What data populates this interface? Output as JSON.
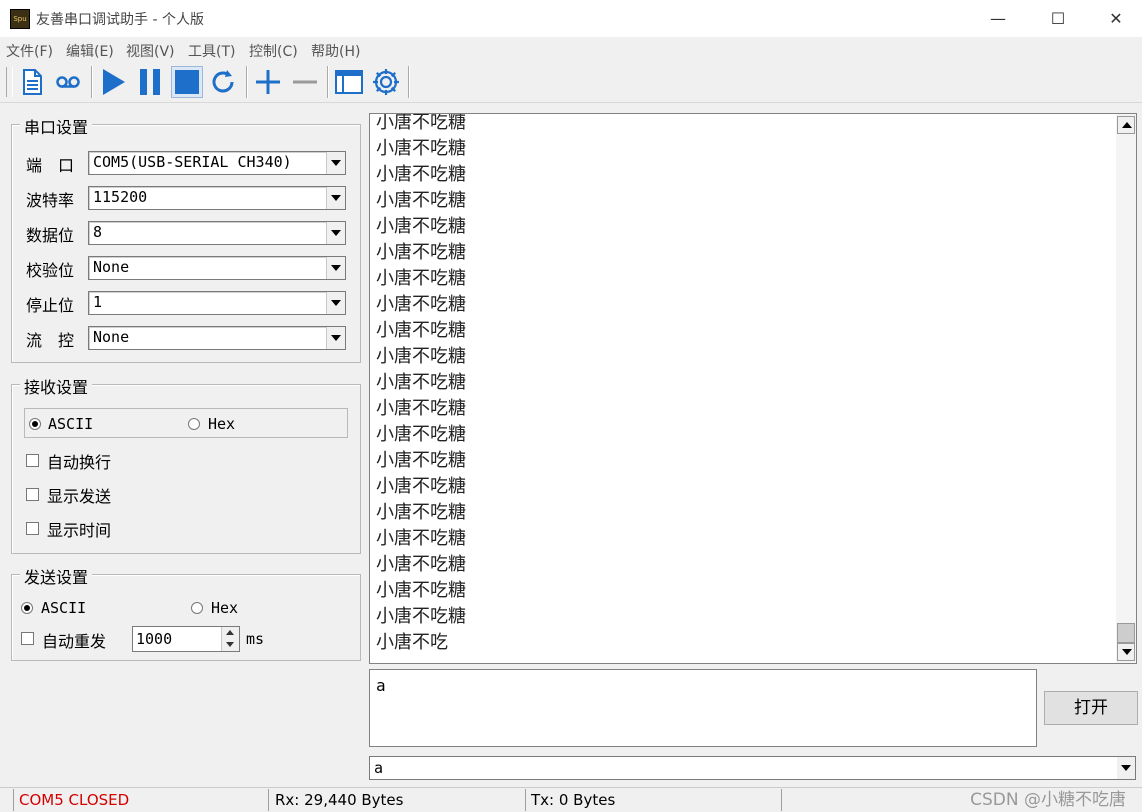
{
  "window": {
    "title": "友善串口调试助手 - 个人版",
    "icon_text": "Spu",
    "minimize": "—",
    "maximize": "☐",
    "close": "✕"
  },
  "menu": [
    "文件(F)",
    "编辑(E)",
    "视图(V)",
    "工具(T)",
    "控制(C)",
    "帮助(H)"
  ],
  "toolbar_icons": [
    "new-document-icon",
    "record-icon",
    "play-icon",
    "pause-icon",
    "stop-icon",
    "refresh-icon",
    "plus-icon",
    "minus-icon",
    "window-icon",
    "gear-icon"
  ],
  "serial_settings": {
    "title": "串口设置",
    "port": {
      "label": "端　口",
      "value": "COM5(USB-SERIAL CH340)"
    },
    "baud": {
      "label": "波特率",
      "value": "115200"
    },
    "databits": {
      "label": "数据位",
      "value": "8"
    },
    "parity": {
      "label": "校验位",
      "value": "None"
    },
    "stopbits": {
      "label": "停止位",
      "value": "1"
    },
    "flow": {
      "label": "流　控",
      "value": "None"
    }
  },
  "receive_settings": {
    "title": "接收设置",
    "ascii_label": "ASCII",
    "hex_label": "Hex",
    "mode": "ASCII",
    "auto_wrap": "自动换行",
    "show_sent": "显示发送",
    "show_time": "显示时间"
  },
  "send_settings": {
    "title": "发送设置",
    "ascii_label": "ASCII",
    "hex_label": "Hex",
    "mode": "ASCII",
    "auto_resend": "自动重发",
    "interval": "1000",
    "unit": "ms"
  },
  "receive_lines": [
    "小唐不吃糖",
    "小唐不吃糖",
    "小唐不吃糖",
    "小唐不吃糖",
    "小唐不吃糖",
    "小唐不吃糖",
    "小唐不吃糖",
    "小唐不吃糖",
    "小唐不吃糖",
    "小唐不吃糖",
    "小唐不吃糖",
    "小唐不吃糖",
    "小唐不吃糖",
    "小唐不吃糖",
    "小唐不吃糖",
    "小唐不吃糖",
    "小唐不吃糖",
    "小唐不吃糖",
    "小唐不吃糖",
    "小唐不吃糖",
    "小唐不吃"
  ],
  "send_text": "a",
  "open_button": "打开",
  "send_combo_value": "a",
  "status": {
    "port_state": "COM5 CLOSED",
    "rx": "Rx: 29,440 Bytes",
    "tx": "Tx: 0 Bytes"
  },
  "watermark": "CSDN @小糖不吃唐",
  "colors": {
    "toolbar_blue": "#1e6fc9",
    "status_red": "#d40000"
  }
}
